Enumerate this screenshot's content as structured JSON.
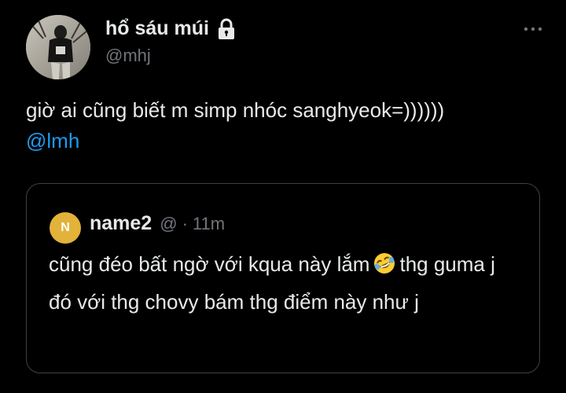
{
  "tweet": {
    "author": {
      "name": "hổ sáu múi",
      "handle": "@mhj",
      "avatar_icon": "profile-photo",
      "protected_icon": "lock-icon"
    },
    "more_icon": "more-horizontal-icon",
    "text": "giờ ai cũng biết m simp nhóc sanghyeok=))))))",
    "mention": "@lmh"
  },
  "quote": {
    "avatar_letter": "N",
    "name": "name2",
    "handle": "@",
    "separator": "·",
    "time": "11m",
    "text_before_emoji": "cũng đéo bất ngờ với kqua này lắm",
    "emoji": "rolling-on-floor-laughing-emoji",
    "text_after_emoji": "thg guma j đó với thg chovy bám thg điểm này như j"
  },
  "colors": {
    "background": "#000000",
    "text_primary": "#e7e9ea",
    "text_secondary": "#71767b",
    "link": "#1d9bf0",
    "border": "#3e4144",
    "quote_avatar_bg": "#e2b23a"
  }
}
